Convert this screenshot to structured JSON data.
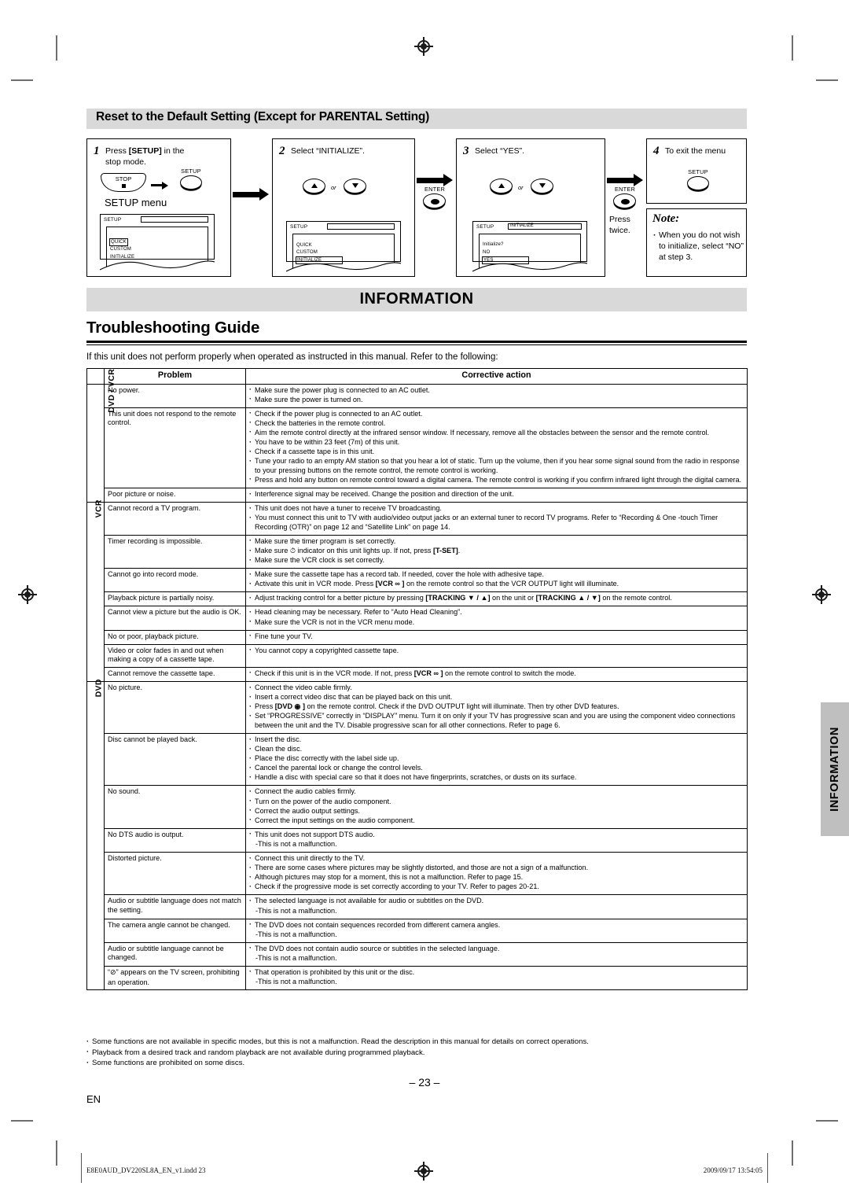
{
  "marks": {
    "registration_icon": "registration-target-icon"
  },
  "side_tab": {
    "label": "INFORMATION"
  },
  "setup_section": {
    "heading": "Reset to the Default Setting (Except for PARENTAL Setting)",
    "steps": [
      {
        "number": "1",
        "title_prefix": "Press ",
        "title_bold": "[SETUP]",
        "title_suffix": " in the",
        "title_line2": "stop mode.",
        "stop_key_label": "STOP",
        "setup_key_label": "SETUP",
        "menu_caption": "SETUP menu",
        "osd": {
          "header": "SETUP",
          "header_value": "",
          "items": [
            "QUICK",
            "CUSTOM",
            "INITIALIZE"
          ],
          "selected": "QUICK"
        }
      },
      {
        "number": "2",
        "title": "Select “INITIALIZE”.",
        "or_label": "or",
        "enter_label": "ENTER",
        "osd": {
          "header": "SETUP",
          "header_value": "",
          "items": [
            "QUICK",
            "CUSTOM",
            "INITIALIZE"
          ],
          "selected": "INITIALIZE"
        }
      },
      {
        "number": "3",
        "title": "Select “YES”.",
        "or_label": "or",
        "enter_label": "ENTER",
        "press_twice": "Press\ntwice.",
        "osd": {
          "header": "SETUP",
          "header_value": "INITIALIZE",
          "prompt": "Initialize?",
          "items": [
            "NO",
            "YES"
          ],
          "selected": "YES"
        }
      },
      {
        "number": "4",
        "title": "To exit the menu",
        "setup_key_label": "SETUP"
      }
    ],
    "note": {
      "title": "Note:",
      "body": "When you do not wish to initialize, select “NO” at step 3."
    }
  },
  "information_banner": "INFORMATION",
  "troubleshooting": {
    "title": "Troubleshooting Guide",
    "intro": "If this unit does not perform properly when operated as instructed in this manual. Refer to the following:",
    "columns": [
      "Problem",
      "Corrective action"
    ],
    "group_labels": {
      "dvd_vcr": "DVD / VCR",
      "vcr": "VCR",
      "dvd": "DVD"
    },
    "rows": [
      {
        "group": "DVD / VCR",
        "problem": "No power.",
        "actions": [
          "Make sure the power plug is connected to an AC outlet.",
          "Make sure the power is turned on."
        ]
      },
      {
        "group": "DVD / VCR",
        "problem": "This unit does not respond to the remote control.",
        "actions": [
          "Check if the power plug is connected to an AC outlet.",
          "Check the batteries in the remote control.",
          "Aim the remote control directly at the infrared sensor window. If necessary, remove all the obstacles between the sensor and the remote control.",
          "You have to be within 23 feet (7m) of this unit.",
          "Check if a cassette tape is in this unit.",
          "Tune your radio to an empty AM station so that you hear a lot of static. Turn up the volume, then if you hear some signal sound from the radio in response to your pressing buttons on the remote control, the remote control is working.",
          "Press and hold any button on remote control toward a digital camera. The remote control is working if you confirm infrared light through the digital camera."
        ]
      },
      {
        "group": "DVD / VCR",
        "problem": "Poor picture or noise.",
        "actions": [
          "Interference signal may be received. Change the position and direction of the unit."
        ]
      },
      {
        "group": "VCR",
        "problem": "Cannot record a TV program.",
        "actions": [
          "This unit does not have a tuner to receive TV broadcasting.",
          "You must connect this unit to TV with audio/video output jacks or an external tuner to record TV programs. Refer to “Recording & One -touch Timer Recording (OTR)” on page 12 and “Satellite Link” on page 14."
        ]
      },
      {
        "group": "VCR",
        "problem": "Timer recording is impossible.",
        "actions": [
          "Make sure the timer program is set correctly.",
          "Make sure ⏱ indicator on this unit lights up. If not, press [T-SET].",
          "Make sure the VCR clock is set correctly."
        ]
      },
      {
        "group": "VCR",
        "problem": "Cannot go into record mode.",
        "actions": [
          "Make sure the cassette tape has a record tab. If needed, cover the hole with adhesive tape.",
          "Activate this unit in VCR mode. Press [VCR ∞ ] on the remote control so that the VCR OUTPUT light will illuminate."
        ]
      },
      {
        "group": "VCR",
        "problem": "Playback picture is partially noisy.",
        "actions": [
          "Adjust tracking control for a better picture by pressing [TRACKING ▼ / ▲] on the unit or [TRACKING ▲ / ▼] on the remote control."
        ]
      },
      {
        "group": "VCR",
        "problem": "Cannot view a picture but the audio is OK.",
        "actions": [
          "Head cleaning may be necessary. Refer to “Auto Head Cleaning”.",
          "Make sure the VCR is not in the VCR menu mode."
        ]
      },
      {
        "group": "VCR",
        "problem": "No or poor, playback picture.",
        "actions": [
          "Fine tune your TV."
        ]
      },
      {
        "group": "VCR",
        "problem": "Video or color fades in and out when making a copy of a cassette tape.",
        "actions": [
          "You cannot copy a copyrighted cassette tape."
        ]
      },
      {
        "group": "VCR",
        "problem": "Cannot remove the cassette tape.",
        "actions": [
          "Check if this unit is in the VCR mode. If not, press [VCR ∞ ] on the remote control to switch the mode."
        ]
      },
      {
        "group": "DVD",
        "problem": "No picture.",
        "actions": [
          "Connect the video cable firmly.",
          "Insert a correct video disc that can be played back on this unit.",
          "Press [DVD ◉ ] on the remote control. Check if the DVD OUTPUT light will illuminate. Then try other DVD features.",
          "Set “PROGRESSIVE” correctly in “DISPLAY” menu. Turn it on only if your TV has progressive scan and you are using the component video connections between the unit and the TV. Disable progressive scan for all other connections. Refer to page 6."
        ]
      },
      {
        "group": "DVD",
        "problem": "Disc cannot be played back.",
        "actions": [
          "Insert the disc.",
          "Clean the disc.",
          "Place the disc correctly with the label side up.",
          "Cancel the parental lock or change the control levels.",
          "Handle a disc with special care so that it does not have fingerprints, scratches, or dusts on its surface."
        ]
      },
      {
        "group": "DVD",
        "problem": "No sound.",
        "actions": [
          "Connect the audio cables firmly.",
          "Turn on the power of the audio component.",
          "Correct the audio output settings.",
          "Correct the input settings on the audio component."
        ]
      },
      {
        "group": "DVD",
        "problem": "No DTS audio is output.",
        "actions": [
          "This unit does not support DTS audio."
        ],
        "sub": [
          "-This is not a malfunction."
        ]
      },
      {
        "group": "DVD",
        "problem": "Distorted picture.",
        "actions": [
          "Connect this unit directly to the TV.",
          "There are some cases where pictures may be slightly distorted, and those are not a sign of a malfunction.",
          "Although pictures may stop for a moment, this is not a malfunction. Refer to page 15.",
          "Check if the progressive mode is set correctly according to your TV. Refer to pages 20-21."
        ]
      },
      {
        "group": "DVD",
        "problem": "Audio or subtitle language does not match the setting.",
        "actions": [
          "The selected language is not available for audio or subtitles on the DVD."
        ],
        "sub": [
          "-This is not a malfunction."
        ]
      },
      {
        "group": "DVD",
        "problem": "The camera angle cannot be changed.",
        "actions": [
          "The DVD does not contain sequences recorded from different camera angles."
        ],
        "sub": [
          "-This is not a malfunction."
        ]
      },
      {
        "group": "DVD",
        "problem": "Audio or subtitle language cannot be changed.",
        "actions": [
          "The DVD does not contain audio source or subtitles in the selected language."
        ],
        "sub": [
          "-This is not a malfunction."
        ]
      },
      {
        "group": "DVD",
        "problem": "“⊘” appears on the TV screen, prohibiting an operation.",
        "actions": [
          "That operation is prohibited by this unit or the disc."
        ],
        "sub": [
          "-This is not a malfunction."
        ]
      }
    ]
  },
  "footnotes": [
    "Some functions are not available in specific modes, but this is not a malfunction. Read the description in this manual for details on correct operations.",
    "Playback from a desired track and random playback are not available during programmed playback.",
    "Some functions are prohibited on some discs."
  ],
  "page_number": "– 23 –",
  "lang_mark": "EN",
  "imprint": {
    "file": "E8E0AUD_DV220SL8A_EN_v1.indd   23",
    "timestamp": "2009/09/17   13:54:05"
  }
}
